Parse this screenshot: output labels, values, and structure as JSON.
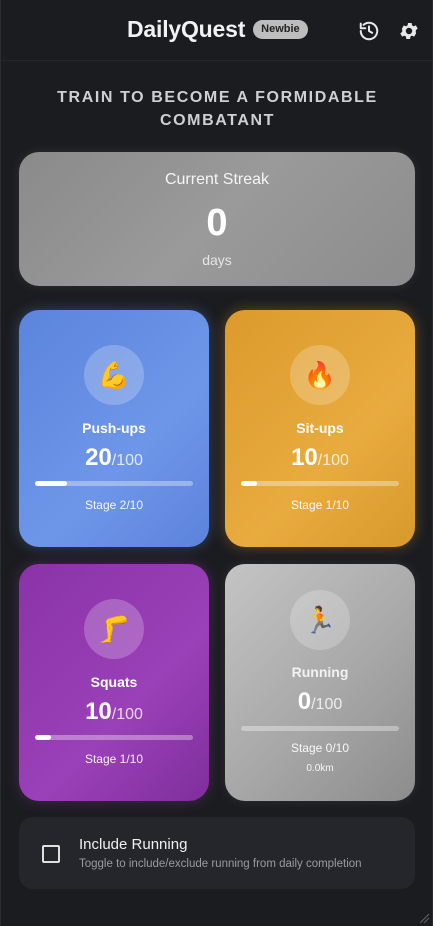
{
  "header": {
    "title": "DailyQuest",
    "rank_badge": "Newbie",
    "icons": [
      "history-icon",
      "settings-icon"
    ]
  },
  "tagline": "TRAIN TO BECOME A FORMIDABLE COMBATANT",
  "streak": {
    "label": "Current Streak",
    "value": "0",
    "unit": "days"
  },
  "exercises": [
    {
      "name": "Push-ups",
      "emoji": "💪",
      "count": "20",
      "goal": "/100",
      "progress": 0.2,
      "stage": "Stage 2/10",
      "color": "#6690e4"
    },
    {
      "name": "Sit-ups",
      "emoji": "🔥",
      "count": "10",
      "goal": "/100",
      "progress": 0.1,
      "stage": "Stage 1/10",
      "color": "#e2a338"
    },
    {
      "name": "Squats",
      "emoji": "🦵",
      "count": "10",
      "goal": "/100",
      "progress": 0.1,
      "stage": "Stage 1/10",
      "color": "#9039ae"
    },
    {
      "name": "Running",
      "emoji": "🏃",
      "count": "0",
      "goal": "/100",
      "progress": 0.0,
      "stage": "Stage 0/10",
      "extra": "0.0km",
      "color": "#a8a8a8"
    }
  ],
  "toggle": {
    "title": "Include Running",
    "subtitle": "Toggle to include/exclude running from daily completion",
    "checked": false
  }
}
